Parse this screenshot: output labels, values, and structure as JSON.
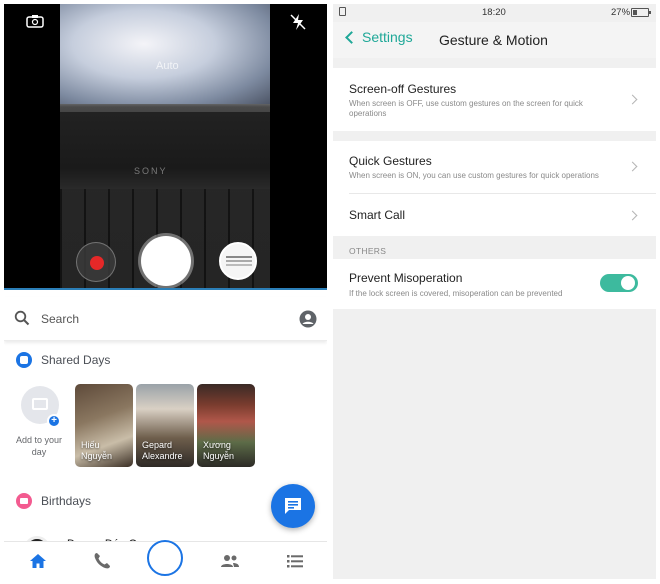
{
  "camera": {
    "mode_label": "Auto",
    "laptop_brand": "SONY"
  },
  "messenger": {
    "search": {
      "placeholder": "Search"
    },
    "shared_days": {
      "title": "Shared Days",
      "add_label": "Add to your day",
      "stories": [
        {
          "name": "Hiếu Nguyễn"
        },
        {
          "name": "Gepard Alexandre"
        },
        {
          "name": "Xương Nguyễn"
        }
      ]
    },
    "birthdays": {
      "title": "Birthdays",
      "contact_name": "Dương Đức Qua"
    },
    "bottom_nav": [
      "home-icon",
      "phone-icon",
      "camera-button",
      "people-icon",
      "list-icon"
    ],
    "accent": "#1b74e4"
  },
  "settings": {
    "status": {
      "time": "18:20",
      "battery": "27%"
    },
    "back_label": "Settings",
    "title": "Gesture & Motion",
    "items": [
      {
        "title": "Screen-off Gestures",
        "subtitle": "When screen is OFF, use custom gestures on the screen for quick operations"
      },
      {
        "title": "Quick Gestures",
        "subtitle": "When screen is ON, you can use custom gestures for quick operations"
      },
      {
        "title": "Smart Call",
        "subtitle": ""
      }
    ],
    "others_header": "OTHERS",
    "prevent": {
      "title": "Prevent Misoperation",
      "subtitle": "If the lock screen is covered, misoperation can be prevented",
      "enabled": true
    },
    "accent": "#1fa898",
    "toggle_color": "#3dba9e"
  }
}
